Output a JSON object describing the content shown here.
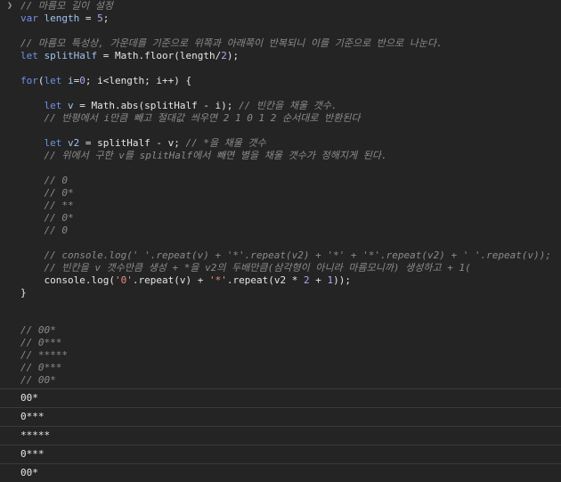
{
  "code_lines": [
    [
      {
        "t": "// 마름모 길이 설정",
        "c": "cm"
      }
    ],
    [
      {
        "t": "var ",
        "c": "kw"
      },
      {
        "t": "length",
        "c": "vr"
      },
      {
        "t": " = ",
        "c": "op"
      },
      {
        "t": "5",
        "c": "nm"
      },
      {
        "t": ";",
        "c": "op"
      }
    ],
    [],
    [
      {
        "t": "// 마름모 특성상, 가운데를 기준으로 위쪽과 아래쪽이 반복되니 이를 기준으로 반으로 나눈다.",
        "c": "cm"
      }
    ],
    [
      {
        "t": "let ",
        "c": "kw"
      },
      {
        "t": "splitHalf",
        "c": "vr"
      },
      {
        "t": " = Math.",
        "c": "op"
      },
      {
        "t": "floor",
        "c": "fn"
      },
      {
        "t": "(length/",
        "c": "op"
      },
      {
        "t": "2",
        "c": "nm"
      },
      {
        "t": ");",
        "c": "op"
      }
    ],
    [],
    [
      {
        "t": "for",
        "c": "kw"
      },
      {
        "t": "(",
        "c": "op"
      },
      {
        "t": "let ",
        "c": "kw"
      },
      {
        "t": "i",
        "c": "vr"
      },
      {
        "t": "=",
        "c": "op"
      },
      {
        "t": "0",
        "c": "nm"
      },
      {
        "t": "; i<length; i++) {",
        "c": "op"
      }
    ],
    [],
    [
      {
        "t": "    let ",
        "c": "kw"
      },
      {
        "t": "v",
        "c": "vr"
      },
      {
        "t": " = Math.",
        "c": "op"
      },
      {
        "t": "abs",
        "c": "fn"
      },
      {
        "t": "(splitHalf - i); ",
        "c": "op"
      },
      {
        "t": "// 빈칸을 채울 갯수.",
        "c": "cm"
      }
    ],
    [
      {
        "t": "    // 반평에서 i만큼 빼고 절대값 씌우면 2 1 0 1 2 순서대로 반환된다",
        "c": "cm"
      }
    ],
    [],
    [
      {
        "t": "    let ",
        "c": "kw"
      },
      {
        "t": "v2",
        "c": "vr"
      },
      {
        "t": " = splitHalf - v; ",
        "c": "op"
      },
      {
        "t": "// *을 채울 갯수",
        "c": "cm"
      }
    ],
    [
      {
        "t": "    // 위에서 구한 v를 splitHalf에서 빼면 별을 채울 갯수가 정해지게 된다.",
        "c": "cm"
      }
    ],
    [],
    [
      {
        "t": "    // 0",
        "c": "cm"
      }
    ],
    [
      {
        "t": "    // 0*",
        "c": "cm"
      }
    ],
    [
      {
        "t": "    // **",
        "c": "cm"
      }
    ],
    [
      {
        "t": "    // 0*",
        "c": "cm"
      }
    ],
    [
      {
        "t": "    // 0",
        "c": "cm"
      }
    ],
    [],
    [
      {
        "t": "    // console.log(' '.repeat(v) + '*'.repeat(v2) + '*' + '*'.repeat(v2) + ' '.repeat(v));",
        "c": "cm"
      }
    ],
    [
      {
        "t": "    // 빈칸을 v 갯수만큼 생성 + *을 v2의 두배만큼(삼각형이 아니라 마름모니까) 생성하고 + 1(",
        "c": "cm"
      }
    ],
    [
      {
        "t": "    console.",
        "c": "op"
      },
      {
        "t": "log",
        "c": "fn"
      },
      {
        "t": "(",
        "c": "op"
      },
      {
        "t": "'0'",
        "c": "st"
      },
      {
        "t": ".",
        "c": "op"
      },
      {
        "t": "repeat",
        "c": "fn"
      },
      {
        "t": "(v) + ",
        "c": "op"
      },
      {
        "t": "'*'",
        "c": "st"
      },
      {
        "t": ".",
        "c": "op"
      },
      {
        "t": "repeat",
        "c": "fn"
      },
      {
        "t": "(v2 * ",
        "c": "op"
      },
      {
        "t": "2",
        "c": "nm"
      },
      {
        "t": " + ",
        "c": "op"
      },
      {
        "t": "1",
        "c": "nm"
      },
      {
        "t": "));",
        "c": "op"
      }
    ],
    [
      {
        "t": "}",
        "c": "op"
      }
    ],
    [],
    [],
    [
      {
        "t": "// 00*",
        "c": "cm"
      }
    ],
    [
      {
        "t": "// 0***",
        "c": "cm"
      }
    ],
    [
      {
        "t": "// *****",
        "c": "cm"
      }
    ],
    [
      {
        "t": "// 0***",
        "c": "cm"
      }
    ],
    [
      {
        "t": "// 00*",
        "c": "cm"
      }
    ]
  ],
  "output_lines": [
    "00*",
    "0***",
    "*****",
    "0***",
    "00*"
  ],
  "colors": {
    "background": "#242424",
    "comment": "#8b8b8b",
    "keyword": "#6f93e8",
    "variable": "#9cc3f2",
    "number": "#b7a1f0",
    "string": "#e88f79",
    "divider": "#3a3a3a"
  },
  "icons": {
    "prompt": "chevron-right-icon"
  }
}
